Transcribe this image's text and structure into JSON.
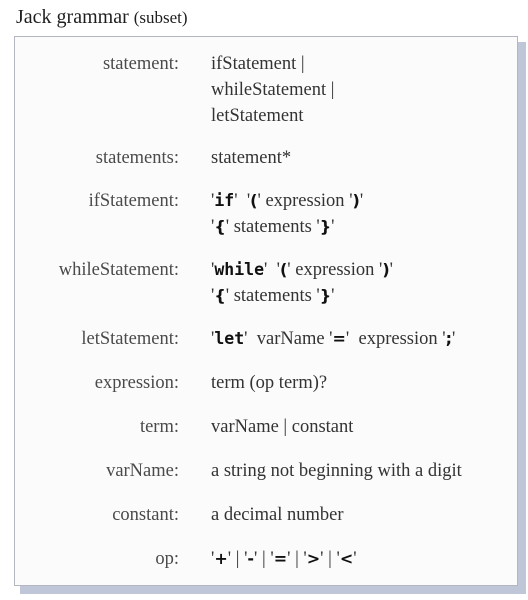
{
  "header": {
    "title": "Jack grammar",
    "subtitle": "(subset)"
  },
  "rules": [
    {
      "name": "statement:",
      "lines": [
        "ifStatement |",
        "whileStatement |",
        "letStatement"
      ]
    },
    {
      "name": "statements:",
      "lines": [
        "statement*"
      ]
    },
    {
      "name": "ifStatement:",
      "line1": {
        "kw": "if",
        "open": "(",
        "mid": "expression",
        "close": ")"
      },
      "line2": {
        "open": "{",
        "mid": "statements",
        "close": "}"
      }
    },
    {
      "name": "whileStatement:",
      "line1": {
        "kw": "while",
        "open": "(",
        "mid": "expression",
        "close": ")"
      },
      "line2": {
        "open": "{",
        "mid": "statements",
        "close": "}"
      }
    },
    {
      "name": "letStatement:",
      "line1": {
        "kw": "let",
        "a": "varName",
        "eq": "=",
        "b": "expression",
        "semi": ";"
      }
    },
    {
      "name": "expression:",
      "lines": [
        "term (op term)?"
      ]
    },
    {
      "name": "term:",
      "lines": [
        "varName | constant"
      ]
    },
    {
      "name": "varName:",
      "lines": [
        "a string not beginning with a digit"
      ]
    },
    {
      "name": "constant:",
      "lines": [
        "a decimal number"
      ]
    },
    {
      "name": "op:",
      "ops": [
        "+",
        "-",
        "=",
        ">",
        "<"
      ]
    }
  ]
}
